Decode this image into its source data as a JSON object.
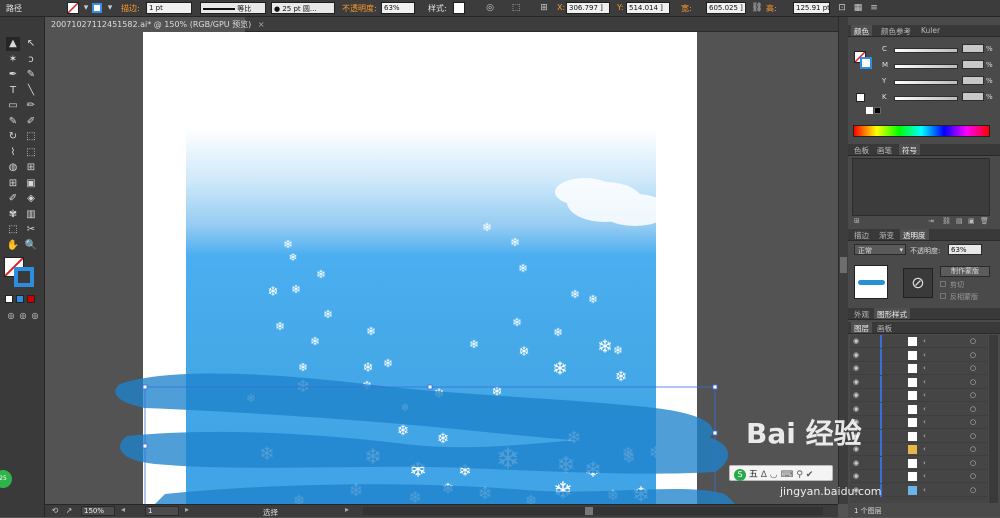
{
  "control_bar": {
    "mode_label": "路径",
    "stroke_label": "描边:",
    "stroke_weight": "1 pt",
    "stroke_style": "等比",
    "brush": "25 pt 圆...",
    "opacity_label": "不透明度:",
    "opacity_value": "63%",
    "style_label": "样式:",
    "x_label": "X:",
    "x_value": "306.797 ]",
    "y_label": "Y:",
    "y_value": "514.014 ]",
    "w_label": "宽:",
    "w_value": "605.025 ]",
    "h_label": "高:",
    "h_value": "125.91 pt"
  },
  "document": {
    "tab_title": "20071027112451582.ai* @ 150% (RGB/GPU 预览)",
    "close_glyph": "×"
  },
  "tools": {
    "icons": [
      "selection-tool-icon",
      "direct-selection-tool-icon",
      "magic-wand-tool-icon",
      "lasso-tool-icon",
      "pen-tool-icon",
      "curvature-tool-icon",
      "type-tool-icon",
      "line-tool-icon",
      "rectangle-tool-icon",
      "paintbrush-tool-icon",
      "pencil-tool-icon",
      "eraser-tool-icon",
      "rotate-tool-icon",
      "scale-tool-icon",
      "warp-tool-icon",
      "free-transform-tool-icon",
      "shape-builder-tool-icon",
      "perspective-grid-tool-icon",
      "mesh-tool-icon",
      "gradient-tool-icon",
      "eyedropper-tool-icon",
      "blend-tool-icon",
      "symbol-sprayer-tool-icon",
      "column-graph-tool-icon",
      "artboard-tool-icon",
      "slice-tool-icon",
      "hand-tool-icon",
      "zoom-tool-icon"
    ],
    "glyphs": [
      "▲",
      "↖",
      "✶",
      "ↄ",
      "✒",
      "✎",
      "T",
      "╲",
      "▭",
      "✏",
      "✎",
      "✐",
      "↻",
      "⬚",
      "⌇",
      "⬚",
      "◍",
      "⊞",
      "⊞",
      "▣",
      "✐",
      "◈",
      "✾",
      "▥",
      "⬚",
      "✂",
      "✋",
      "🔍"
    ]
  },
  "status_bar": {
    "zoom": "150%",
    "artboard_num": "1",
    "tool_name": "选择"
  },
  "color_panel": {
    "tabs": [
      "颜色",
      "颜色参考",
      "Kuler"
    ],
    "channels": [
      "C",
      "M",
      "Y",
      "K"
    ],
    "pct": "%"
  },
  "swatch_panel": {
    "tabs": [
      "色板",
      "画笔",
      "符号"
    ]
  },
  "transparency_panel": {
    "tabs": [
      "描边",
      "渐变",
      "透明度"
    ],
    "blend_mode": "正常",
    "opacity_label": "不透明度:",
    "opacity_value": "63%",
    "make_mask": "制作蒙版",
    "clip": "剪切",
    "invert_mask": "反相蒙版"
  },
  "appearance_panel": {
    "tabs": [
      "外观",
      "图形样式"
    ]
  },
  "layers_panel": {
    "tabs": [
      "图层",
      "画板"
    ],
    "row_count": 12,
    "footer": "1 个图层"
  },
  "colors": {
    "accent_orange": "#ff9a2e",
    "selection_blue": "#3a6fd8",
    "sky_blue": "#45a9e8"
  },
  "overlay": {
    "ime_label": "五",
    "watermark": "Bai 经验",
    "watermark_url": "jingyan.baidu.com",
    "badge": "25"
  }
}
